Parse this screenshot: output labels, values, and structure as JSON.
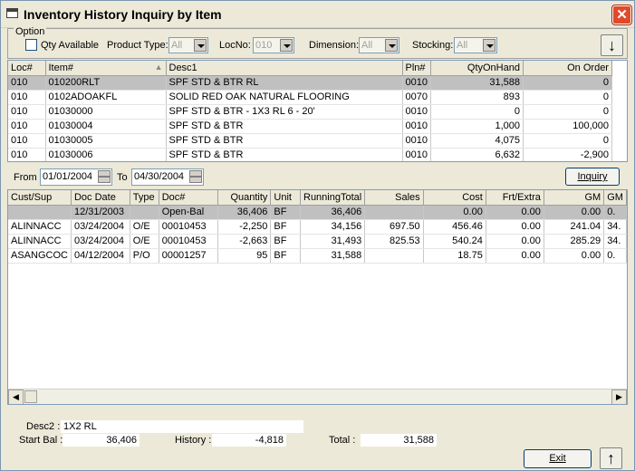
{
  "window": {
    "title": "Inventory History Inquiry by Item",
    "close_glyph": "✕"
  },
  "option": {
    "legend": "Option",
    "qty_available_label": "Qty Available",
    "product_type_label": "Product Type:",
    "product_type_value": "All",
    "locno_label": "LocNo:",
    "locno_value": "010",
    "dimension_label": "Dimension:",
    "dimension_value": "All",
    "stocking_label": "Stocking:",
    "stocking_value": "All",
    "down_glyph": "↓"
  },
  "items_grid": {
    "headers": [
      "Loc#",
      "Item#",
      "Desc1",
      "Pln#",
      "QtyOnHand",
      "On Order"
    ],
    "rows": [
      [
        "010",
        "010200RLT",
        "SPF STD & BTR RL",
        "0010",
        "31,588",
        "0"
      ],
      [
        "010",
        "0102ADOAKFL",
        "SOLID RED OAK NATURAL FLOORING",
        "0070",
        "893",
        "0"
      ],
      [
        "010",
        "01030000",
        "SPF STD & BTR - 1X3 RL 6 - 20'",
        "0010",
        "0",
        "0"
      ],
      [
        "010",
        "01030004",
        "SPF STD & BTR",
        "0010",
        "1,000",
        "100,000"
      ],
      [
        "010",
        "01030005",
        "SPF STD & BTR",
        "0010",
        "4,075",
        "0"
      ],
      [
        "010",
        "01030006",
        "SPF STD & BTR",
        "0010",
        "6,632",
        "-2,900"
      ]
    ]
  },
  "dates": {
    "from_label": "From :",
    "from_value": "01/01/2004",
    "to_label": "To",
    "to_value": "04/30/2004",
    "inquiry_label": "Inquiry"
  },
  "history_grid": {
    "headers": [
      "Cust/Sup",
      "Doc Date",
      "Type",
      "Doc#",
      "Quantity",
      "Unit",
      "RunningTotal",
      "Sales",
      "Cost",
      "Frt/Extra",
      "GM",
      "GM"
    ],
    "rows": [
      [
        "",
        "12/31/2003",
        "",
        "Open-Bal",
        "36,406",
        "BF",
        "36,406",
        "",
        "0.00",
        "0.00",
        "0.00",
        "0."
      ],
      [
        "ALINNACC",
        "03/24/2004",
        "O/E",
        "00010453",
        "-2,250",
        "BF",
        "34,156",
        "697.50",
        "456.46",
        "0.00",
        "241.04",
        "34."
      ],
      [
        "ALINNACC",
        "03/24/2004",
        "O/E",
        "00010453",
        "-2,663",
        "BF",
        "31,493",
        "825.53",
        "540.24",
        "0.00",
        "285.29",
        "34."
      ],
      [
        "ASANGCOC",
        "04/12/2004",
        "P/O",
        "00001257",
        "95",
        "BF",
        "31,588",
        "",
        "18.75",
        "0.00",
        "0.00",
        "0."
      ]
    ]
  },
  "footer": {
    "desc2_label": "Desc2 :",
    "desc2_value": "1X2 RL",
    "start_bal_label": "Start Bal :",
    "start_bal_value": "36,406",
    "history_label": "History :",
    "history_value": "-4,818",
    "total_label": "Total :",
    "total_value": "31,588",
    "exit_label": "Exit",
    "up_glyph": "↑"
  }
}
